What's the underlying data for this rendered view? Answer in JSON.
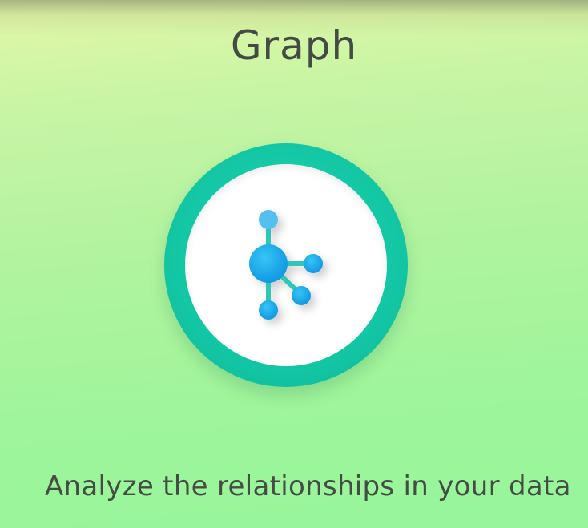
{
  "title": "Graph",
  "description": "Analyze the relationships in your data",
  "icon": {
    "name": "graph-network-icon",
    "ring_color": "#15c9a7",
    "inner_color": "#ffffff",
    "node_color": "#13a8e8",
    "edge_color": "#2ec6b8"
  }
}
